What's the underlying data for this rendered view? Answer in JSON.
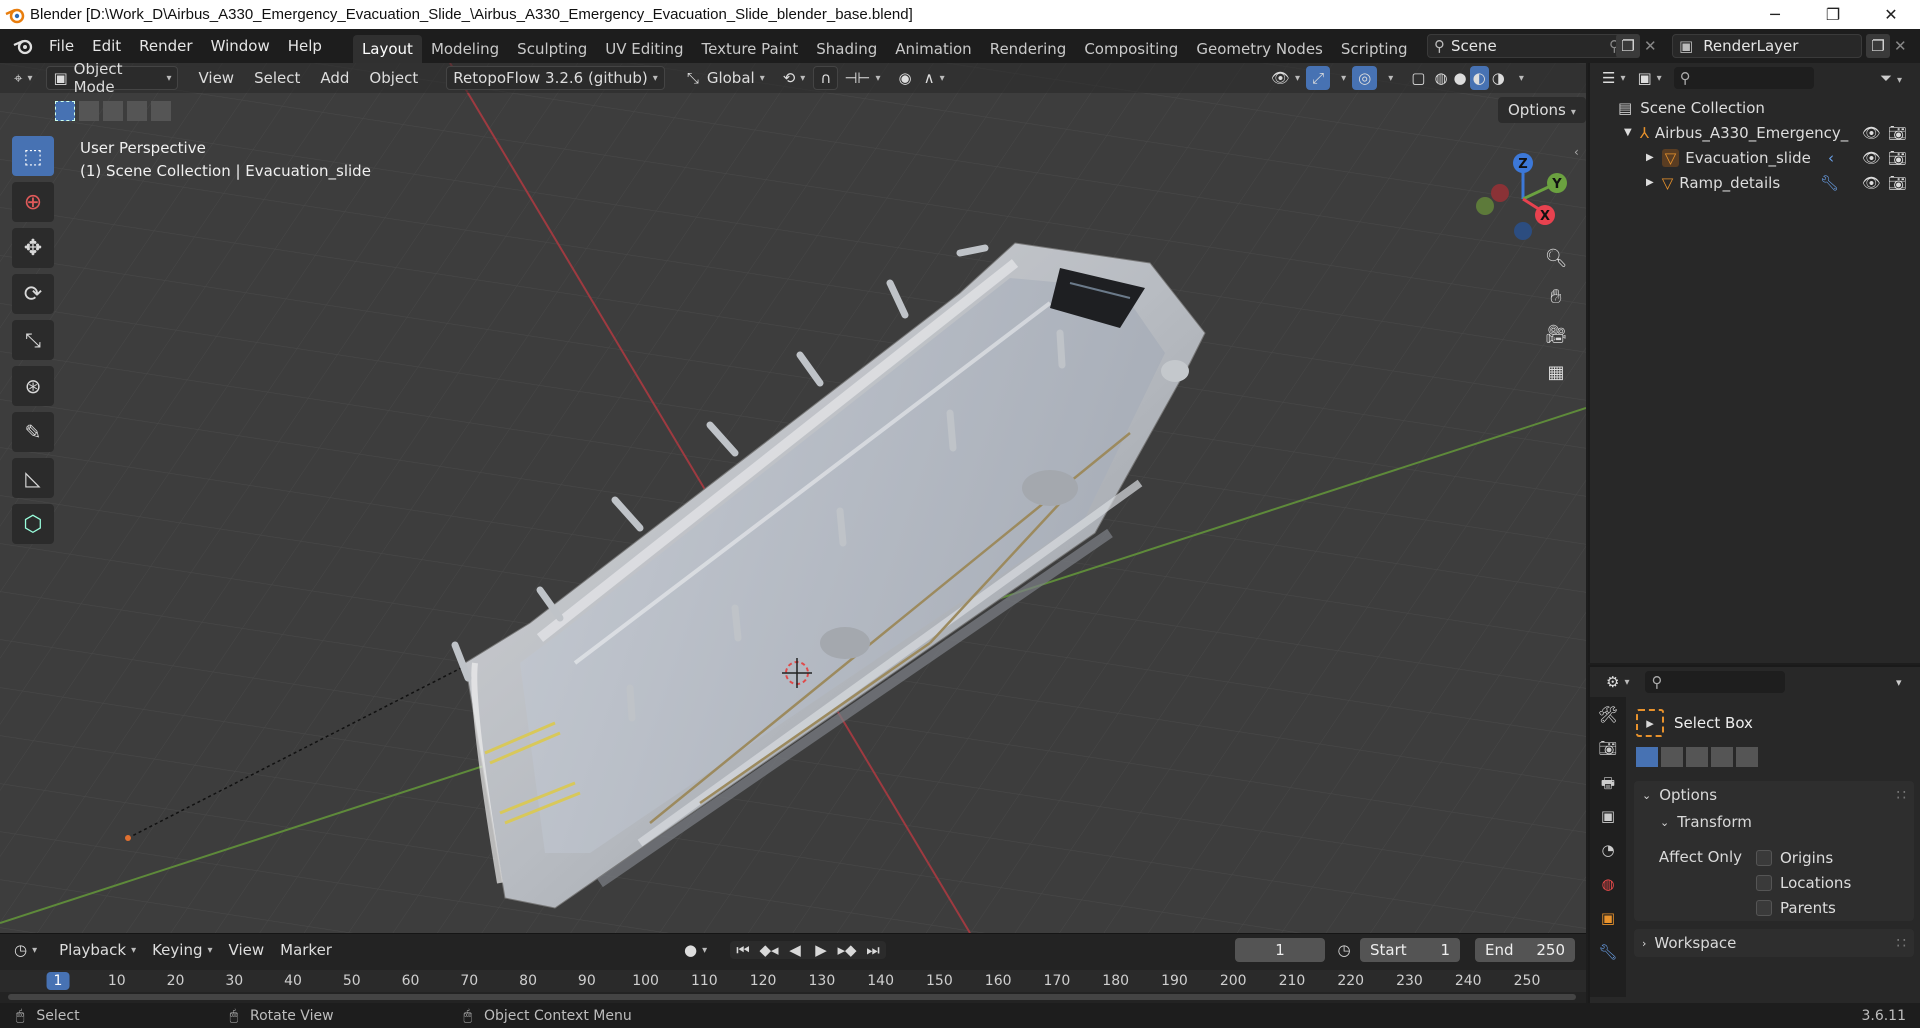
{
  "window": {
    "title": "Blender [D:\\Work_D\\Airbus_A330_Emergency_Evacuation_Slide_\\Airbus_A330_Emergency_Evacuation_Slide_blender_base.blend]",
    "minimize": "─",
    "restore": "❐",
    "close": "✕"
  },
  "menus": [
    "File",
    "Edit",
    "Render",
    "Window",
    "Help"
  ],
  "workspaces": [
    "Layout",
    "Modeling",
    "Sculpting",
    "UV Editing",
    "Texture Paint",
    "Shading",
    "Animation",
    "Rendering",
    "Compositing",
    "Geometry Nodes",
    "Scripting"
  ],
  "active_workspace": "Layout",
  "add_workspace": "+",
  "scene": {
    "name": "Scene",
    "view_layer": "RenderLayer"
  },
  "viewport_header": {
    "mode": "Object Mode",
    "menus": [
      "View",
      "Select",
      "Add",
      "Object"
    ],
    "addon": "RetopoFlow 3.2.6 (github)",
    "orientation": "Global",
    "options_label": "Options"
  },
  "viewport": {
    "perspective": "User Perspective",
    "collection_info": "(1) Scene Collection | Evacuation_slide",
    "gizmo": {
      "z": "Z",
      "y": "Y",
      "x": "X"
    }
  },
  "toolbar": [
    "select-box",
    "cursor",
    "move",
    "rotate",
    "scale",
    "transform",
    "annotate",
    "measure",
    "add-cube"
  ],
  "outliner": {
    "root": "Scene Collection",
    "items": [
      {
        "name": "Airbus_A330_Emergency_",
        "depth": 1,
        "type": "empty"
      },
      {
        "name": "Evacuation_slide",
        "depth": 2,
        "type": "mesh"
      },
      {
        "name": "Ramp_details",
        "depth": 2,
        "type": "mesh"
      }
    ]
  },
  "properties": {
    "tool_name": "Select Box",
    "options_label": "Options",
    "transform_label": "Transform",
    "affect_only_label": "Affect Only",
    "affect_only": [
      "Origins",
      "Locations",
      "Parents"
    ],
    "workspace_label": "Workspace"
  },
  "timeline": {
    "menus": [
      "Playback",
      "Keying",
      "View",
      "Marker"
    ],
    "current_frame": "1",
    "start_label": "Start",
    "start": "1",
    "end_label": "End",
    "end": "250",
    "ruler": [
      "1",
      "10",
      "20",
      "30",
      "40",
      "50",
      "60",
      "70",
      "80",
      "90",
      "100",
      "110",
      "120",
      "130",
      "140",
      "150",
      "160",
      "170",
      "180",
      "190",
      "200",
      "210",
      "220",
      "230",
      "240",
      "250"
    ]
  },
  "status": {
    "select": "Select",
    "rotate": "Rotate View",
    "context": "Object Context Menu",
    "version": "3.6.11"
  },
  "colors": {
    "accent": "#4772b3",
    "x_axis": "#e8424f",
    "y_axis": "#6ba140",
    "z_axis": "#3c78d8"
  }
}
